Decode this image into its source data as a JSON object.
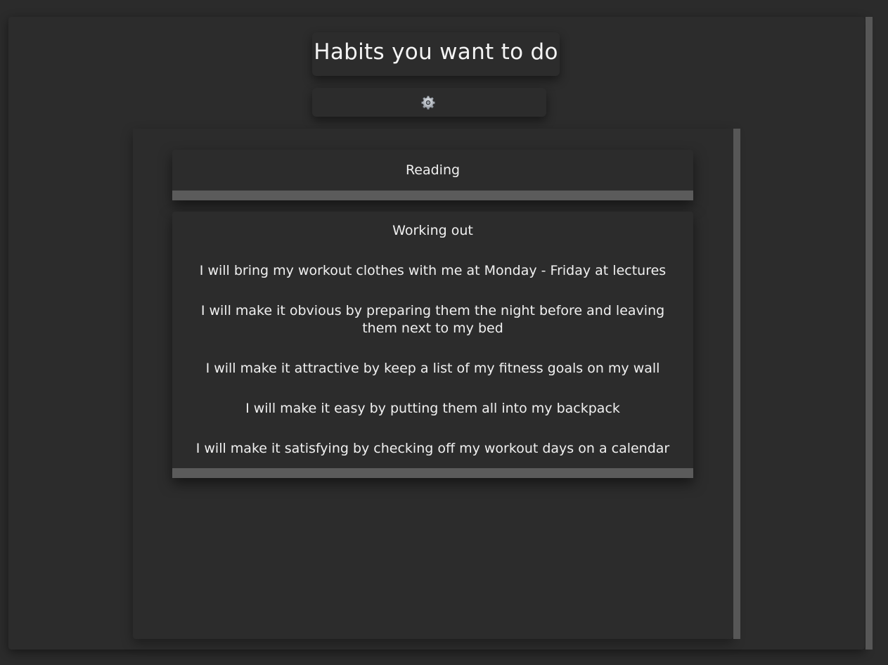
{
  "header": {
    "title": "Habits you want to do",
    "settings_icon": "gear-icon"
  },
  "habits": [
    {
      "name": "Reading",
      "lines": []
    },
    {
      "name": "Working out",
      "lines": [
        "I will bring my workout clothes with me at Monday - Friday at lectures",
        "I will make it obvious by preparing them the night before and leaving them next to my bed",
        "I will make it attractive by keep a list of my fitness goals on my wall",
        "I will make it easy by putting them all into my backpack",
        "I will make it satisfying by checking off my workout days on a calendar"
      ]
    }
  ],
  "colors": {
    "background": "#2b2b2b",
    "card": "#2c2c2c",
    "bar": "#5b5b5b",
    "scrollbar": "#575757",
    "text": "#f0f0f0"
  }
}
